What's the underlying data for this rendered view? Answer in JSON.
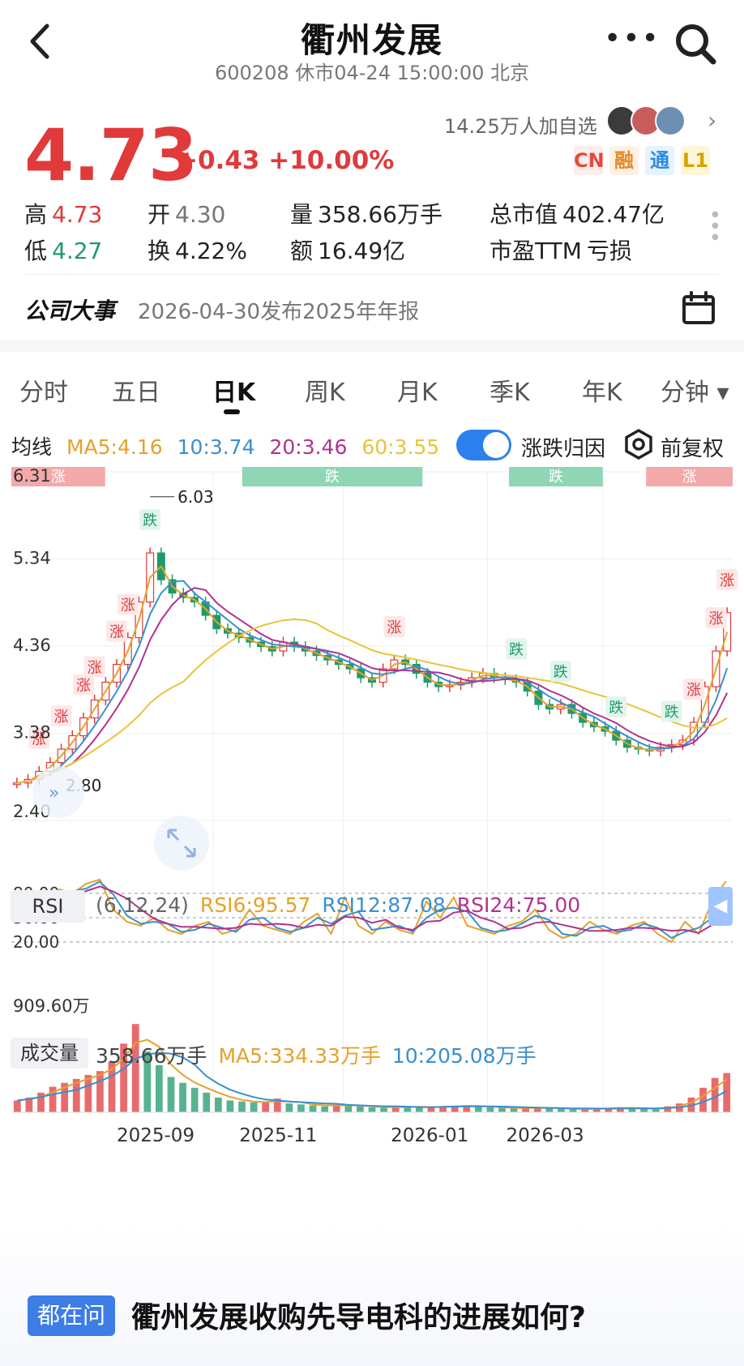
{
  "header": {
    "title": "衢州发展",
    "subtitle": "600208 休市04-24 15:00:00 北京"
  },
  "quote": {
    "price": "4.73",
    "change": "+0.43 +10.00%",
    "followers": "14.25万人加自选",
    "tags": [
      "CN",
      "融",
      "通",
      "L1"
    ],
    "high_label": "高",
    "high": "4.73",
    "low_label": "低",
    "low": "4.27",
    "open_label": "开",
    "open": "4.30",
    "turnover_label": "换",
    "turnover": "4.22%",
    "volume_label": "量",
    "volume": "358.66万手",
    "amount_label": "额",
    "amount": "16.49亿",
    "mktcap_label": "总市值",
    "mktcap": "402.47亿",
    "pe_label": "市盈TTM",
    "pe": "亏损"
  },
  "event": {
    "label": "公司大事",
    "text": "2026-04-30发布2025年年报"
  },
  "tabs": [
    "分时",
    "五日",
    "日K",
    "周K",
    "月K",
    "季K",
    "年K",
    "分钟 ▾"
  ],
  "active_tab": "日K",
  "ma_legend": {
    "label": "均线",
    "ma5": "MA5:4.16",
    "ma10": "10:3.74",
    "ma20": "20:3.46",
    "ma60": "60:3.55"
  },
  "toggle_label": "涨跌归因",
  "adjust_label": "前复权",
  "rsi_legend": {
    "button": "RSI",
    "params": "(6,12,24)",
    "rsi6": "RSI6:95.57",
    "rsi12": "RSI12:87.08",
    "rsi24": "RSI24:75.00"
  },
  "vol_legend": {
    "button": "成交量",
    "vol": "358.66万手",
    "ma5": "MA5:334.33万手",
    "ma10": "10:205.08万手"
  },
  "ask": {
    "badge": "都在问",
    "question": "衢州发展收购先导电科的进展如何?"
  },
  "colors": {
    "up": "#e03a3a",
    "down": "#1f9a6a",
    "ma5": "#e5a12b",
    "ma10": "#3a8fd0",
    "ma20": "#b0338f",
    "ma60": "#e8c43a"
  },
  "chart_data": {
    "type": "candlestick",
    "price_axis_labels": [
      "6.31",
      "5.34",
      "4.36",
      "3.38",
      "2.40"
    ],
    "ylim": [
      2.4,
      6.31
    ],
    "max_marker": "6.03",
    "min_marker": "2.80",
    "x_tick_labels": [
      "2025-09",
      "2025-11",
      "2026-01",
      "2026-03"
    ],
    "closes_sampled": [
      2.82,
      2.86,
      2.95,
      3.05,
      3.2,
      3.35,
      3.55,
      3.75,
      3.95,
      4.15,
      4.45,
      4.85,
      5.4,
      5.1,
      4.95,
      4.9,
      4.85,
      4.7,
      4.55,
      4.5,
      4.45,
      4.4,
      4.35,
      4.3,
      4.4,
      4.35,
      4.3,
      4.25,
      4.2,
      4.15,
      4.1,
      4.0,
      3.95,
      4.1,
      4.2,
      4.15,
      4.05,
      3.95,
      3.9,
      3.92,
      3.95,
      4.0,
      4.05,
      4.0,
      3.98,
      3.95,
      3.85,
      3.7,
      3.65,
      3.7,
      3.6,
      3.5,
      3.45,
      3.4,
      3.3,
      3.22,
      3.2,
      3.18,
      3.22,
      3.25,
      3.3,
      3.5,
      3.9,
      4.3,
      4.73
    ],
    "event_markers": [
      {
        "label": "涨",
        "i": 2
      },
      {
        "label": "涨",
        "i": 4
      },
      {
        "label": "涨",
        "i": 6
      },
      {
        "label": "涨",
        "i": 7
      },
      {
        "label": "涨",
        "i": 9
      },
      {
        "label": "涨",
        "i": 10
      },
      {
        "label": "跌",
        "i": 12
      },
      {
        "label": "涨",
        "i": 34
      },
      {
        "label": "跌",
        "i": 45
      },
      {
        "label": "跌",
        "i": 49
      },
      {
        "label": "跌",
        "i": 54
      },
      {
        "label": "跌",
        "i": 59
      },
      {
        "label": "涨",
        "i": 61
      },
      {
        "label": "涨",
        "i": 63
      },
      {
        "label": "涨",
        "i": 64
      }
    ],
    "top_bands": [
      {
        "label": "涨",
        "x0": 0.0,
        "x1": 0.13,
        "type": "up"
      },
      {
        "label": "跌",
        "x0": 0.32,
        "x1": 0.57,
        "type": "down"
      },
      {
        "label": "跌",
        "x0": 0.69,
        "x1": 0.82,
        "type": "down"
      },
      {
        "label": "涨",
        "x0": 0.88,
        "x1": 1.0,
        "type": "up"
      }
    ],
    "rsi_levels": [
      "80.00",
      "50.00",
      "20.00"
    ],
    "rsi6_sampled": [
      55,
      65,
      75,
      85,
      80,
      92,
      97,
      60,
      45,
      40,
      50,
      35,
      30,
      40,
      45,
      30,
      35,
      60,
      40,
      35,
      30,
      45,
      55,
      30,
      75,
      40,
      30,
      45,
      35,
      30,
      70,
      50,
      75,
      40,
      35,
      30,
      40,
      45,
      60,
      35,
      25,
      30,
      45,
      35,
      30,
      40,
      45,
      30,
      20,
      45,
      30,
      70,
      95
    ],
    "vol_axis_label": "909.60万",
    "volume_sampled": [
      120,
      150,
      200,
      260,
      300,
      340,
      380,
      420,
      520,
      700,
      900,
      620,
      480,
      360,
      300,
      250,
      200,
      150,
      120,
      110,
      100,
      100,
      140,
      90,
      80,
      70,
      60,
      80,
      70,
      60,
      50,
      45,
      60,
      55,
      50,
      55,
      60,
      65,
      70,
      55,
      50,
      45,
      40,
      45,
      50,
      40,
      35,
      30,
      35,
      40,
      45,
      50,
      40,
      35,
      30,
      60,
      90,
      150,
      250,
      350,
      400
    ]
  }
}
